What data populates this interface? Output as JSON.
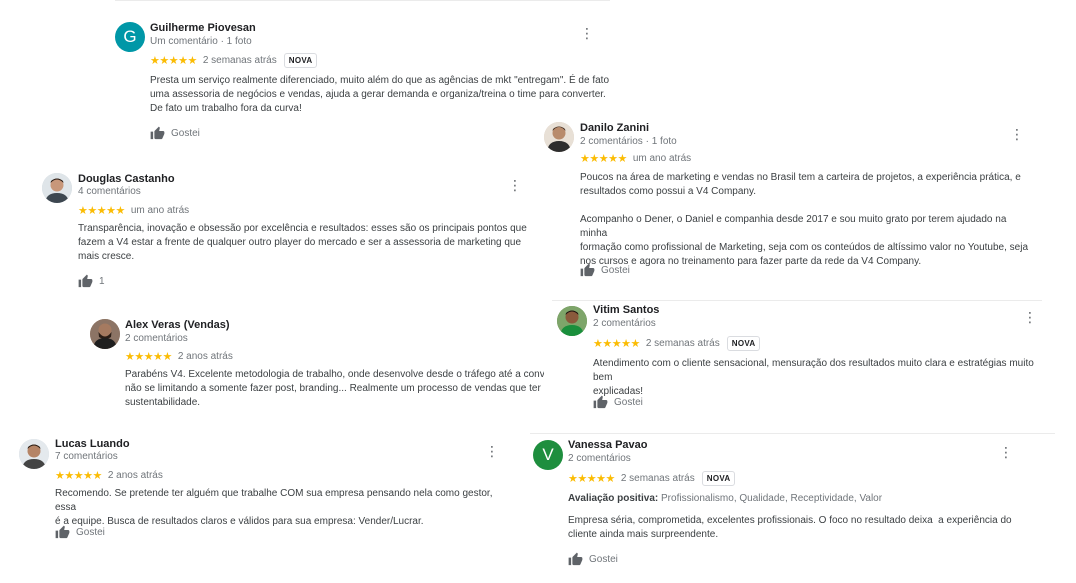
{
  "reviews": [
    {
      "name": "Guilherme Piovesan",
      "sub": "Um comentário · 1 foto",
      "initial": "G",
      "avatar_color": "#0097a7",
      "stars": "★★★★★",
      "when": "2 semanas atrás",
      "badge": "NOVA",
      "text": [
        "Presta um serviço realmente diferenciado, muito além do que as agências de mkt \"entregam\". É de fato",
        "uma assessoria de negócios e vendas, ajuda a gerar demanda e organiza/treina o time para converter.",
        "De fato um trabalho fora da curva!"
      ],
      "like_label": "Gostei"
    },
    {
      "name": "Danilo Zanini",
      "sub": "2 comentários · 1 foto",
      "stars": "★★★★★",
      "when": "um ano atrás",
      "text": [
        "Poucos na área de marketing e vendas no Brasil tem a carteira de projetos, a experiência prática, e",
        "resultados como possui a V4 Company.",
        " ",
        "Acompanho o Dener, o Daniel e companhia desde 2017 e sou muito grato por terem ajudado na minha",
        "formação como profissional de Marketing, seja com os conteúdos de altíssimo valor no Youtube, seja",
        "nos cursos e agora no treinamento para fazer parte da rede da V4 Company."
      ],
      "like_label": "Gostei"
    },
    {
      "name": "Douglas Castanho",
      "sub": "4 comentários",
      "stars": "★★★★★",
      "when": "um ano atrás",
      "text": [
        "Transparência, inovação e obsessão por excelência e resultados: esses são os principais pontos que",
        "fazem a V4 estar a frente de qualquer outro player do mercado e ser a assessoria de marketing que",
        "mais cresce."
      ],
      "like_label": "1"
    },
    {
      "name": "Alex Veras (Vendas)",
      "sub": "2 comentários",
      "stars": "★★★★★",
      "when": "2 anos atrás",
      "text": [
        "Parabéns V4. Excelente metodologia de trabalho, onde desenvolve desde o tráfego até a conv",
        "não se limitando a somente fazer post, branding... Realmente um processo de vendas que ter",
        "sustentabilidade."
      ]
    },
    {
      "name": "Vitim Santos",
      "sub": "2 comentários",
      "stars": "★★★★★",
      "when": "2 semanas atrás",
      "badge": "NOVA",
      "text": [
        "Atendimento com o cliente sensacional, mensuração dos resultados muito clara e estratégias muito bem",
        "explicadas!"
      ],
      "like_label": "Gostei"
    },
    {
      "name": "Lucas Luando",
      "sub": "7 comentários",
      "stars": "★★★★★",
      "when": "2 anos atrás",
      "text": [
        "Recomendo. Se pretende ter alguém que trabalhe COM sua empresa pensando nela como gestor, essa",
        "é a equipe. Busca de resultados claros e válidos para sua empresa: Vender/Lucrar."
      ],
      "like_label": "Gostei"
    },
    {
      "name": "Vanessa Pavao",
      "sub": "2 comentários",
      "initial": "V",
      "avatar_color": "#1e8e3e",
      "stars": "★★★★★",
      "when": "2 semanas atrás",
      "badge": "NOVA",
      "rated_label": "Avaliação positiva:",
      "rated_values": "Profissionalismo, Qualidade, Receptividade, Valor",
      "text": [
        "Empresa séria, comprometida, excelentes profissionais. O foco no resultado deixa  a experiência do",
        "cliente ainda mais surpreendente."
      ],
      "like_label": "Gostei"
    }
  ],
  "colors": {
    "star": "#fbbc04",
    "name": "#202124",
    "secondary": "#70757a"
  },
  "icons": {
    "like": "thumbs-up-icon",
    "more": "more-vert-icon"
  }
}
